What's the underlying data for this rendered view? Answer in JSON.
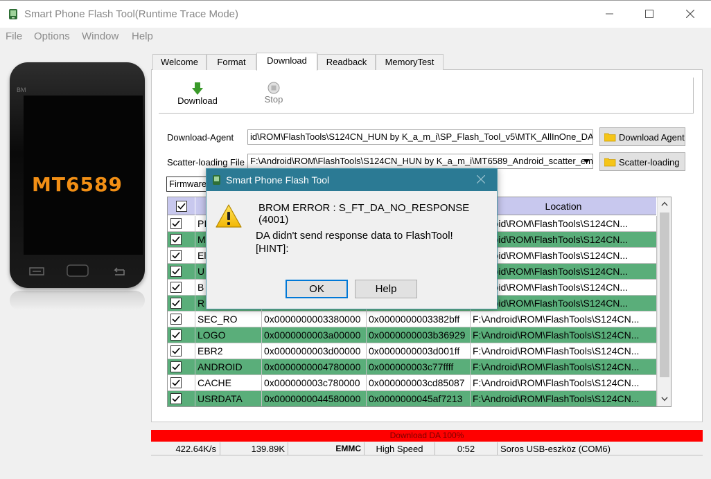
{
  "window": {
    "title": "Smart Phone Flash Tool(Runtime Trace Mode)"
  },
  "menu": [
    "File",
    "Options",
    "Window",
    "Help"
  ],
  "phone": {
    "model": "MT6589",
    "brand": "BM"
  },
  "tabs": [
    "Welcome",
    "Format",
    "Download",
    "Readback",
    "MemoryTest"
  ],
  "toolbar": {
    "download_label": "Download",
    "stop_label": "Stop"
  },
  "download_agent": {
    "label": "Download-Agent",
    "value": "id\\ROM\\FlashTools\\S124CN_HUN by K_a_m_i\\SP_Flash_Tool_v5\\MTK_AllInOne_DA.bin",
    "button": "Download Agent"
  },
  "scatter": {
    "label": "Scatter-loading File",
    "value": "F:\\Android\\ROM\\FlashTools\\S124CN_HUN by K_a_m_i\\MT6589_Android_scatter_em",
    "button": "Scatter-loading"
  },
  "firmware_label": "Firmware",
  "table": {
    "location_header": "Location",
    "rows": [
      {
        "name": "PI",
        "begin": "",
        "end": "",
        "location": "Android\\ROM\\FlashTools\\S124CN..."
      },
      {
        "name": "M",
        "begin": "",
        "end": "",
        "location": "Android\\ROM\\FlashTools\\S124CN..."
      },
      {
        "name": "El",
        "begin": "",
        "end": "",
        "location": "Android\\ROM\\FlashTools\\S124CN..."
      },
      {
        "name": "U",
        "begin": "",
        "end": "",
        "location": "Android\\ROM\\FlashTools\\S124CN..."
      },
      {
        "name": "B",
        "begin": "",
        "end": "",
        "location": "Android\\ROM\\FlashTools\\S124CN..."
      },
      {
        "name": "R",
        "begin": "",
        "end": "",
        "location": "Android\\ROM\\FlashTools\\S124CN..."
      },
      {
        "name": "SEC_RO",
        "begin": "0x0000000003380000",
        "end": "0x0000000003382bff",
        "location": "F:\\Android\\ROM\\FlashTools\\S124CN..."
      },
      {
        "name": "LOGO",
        "begin": "0x0000000003a00000",
        "end": "0x0000000003b36929",
        "location": "F:\\Android\\ROM\\FlashTools\\S124CN..."
      },
      {
        "name": "EBR2",
        "begin": "0x0000000003d00000",
        "end": "0x0000000003d001ff",
        "location": "F:\\Android\\ROM\\FlashTools\\S124CN..."
      },
      {
        "name": "ANDROID",
        "begin": "0x0000000004780000",
        "end": "0x000000003c77ffff",
        "location": "F:\\Android\\ROM\\FlashTools\\S124CN..."
      },
      {
        "name": "CACHE",
        "begin": "0x000000003c780000",
        "end": "0x000000003cd85087",
        "location": "F:\\Android\\ROM\\FlashTools\\S124CN..."
      },
      {
        "name": "USRDATA",
        "begin": "0x0000000044580000",
        "end": "0x0000000045af7213",
        "location": "F:\\Android\\ROM\\FlashTools\\S124CN..."
      }
    ]
  },
  "progress": {
    "text": "Download DA 100%",
    "percent": 100
  },
  "status": {
    "speed": "422.64K/s",
    "size": "139.89K",
    "storage": "EMMC",
    "usb_mode": "High Speed",
    "time": "0:52",
    "port": "Soros USB-eszköz (COM6)"
  },
  "dialog": {
    "title": "Smart Phone Flash Tool",
    "error": "BROM ERROR : S_FT_DA_NO_RESPONSE (4001)",
    "message": "DA didn't send response data to FlashTool!",
    "hint": "[HINT]:",
    "ok": "OK",
    "help": "Help"
  },
  "colors": {
    "accent": "#2b7a94",
    "row_highlight": "#5aae7a",
    "header": "#c8c8ee",
    "progress": "#ff0000",
    "phone_model": "#f28f15"
  }
}
